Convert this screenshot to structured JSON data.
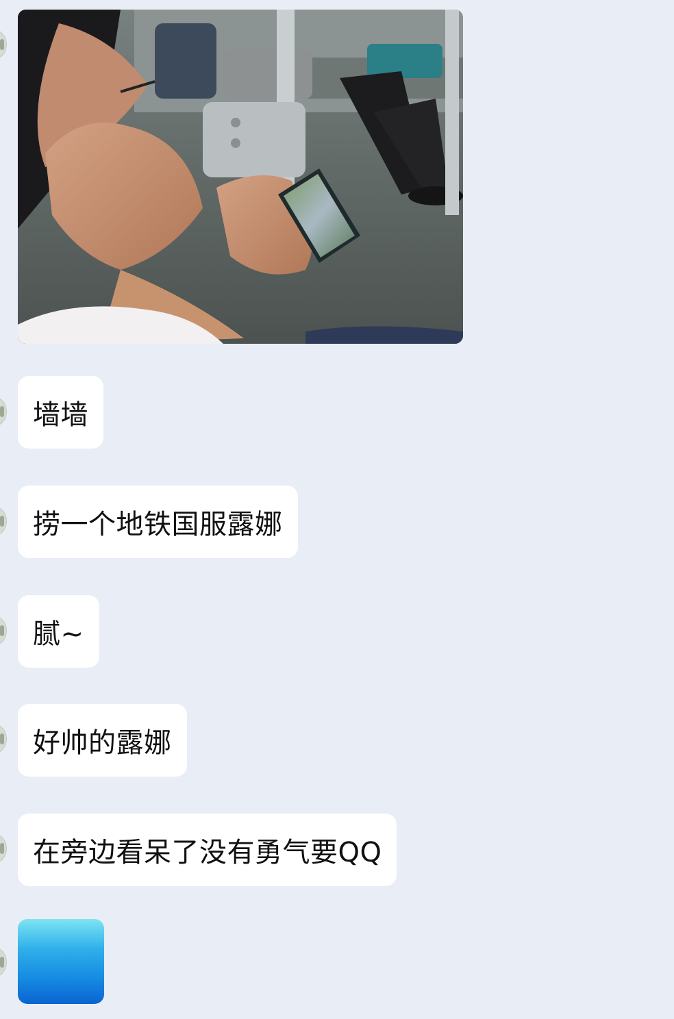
{
  "messages": [
    {
      "type": "image",
      "image": "photo-subway-passenger-playing-mobile-game"
    },
    {
      "type": "text",
      "text": "墙墙"
    },
    {
      "type": "text",
      "text": "捞一个地铁国服露娜"
    },
    {
      "type": "text",
      "text": "腻~"
    },
    {
      "type": "text",
      "text": "好帅的露娜"
    },
    {
      "type": "text",
      "text": "在旁边看呆了没有勇气要QQ"
    },
    {
      "type": "image",
      "image": "blue-gradient-thumbnail"
    }
  ],
  "colors": {
    "background": "#e9edf5",
    "bubble": "#ffffff",
    "text": "#111111"
  }
}
